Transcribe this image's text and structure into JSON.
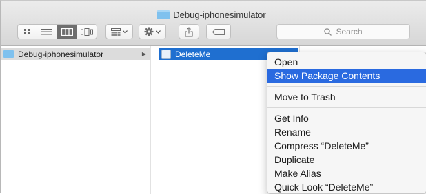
{
  "window": {
    "title": "Debug-iphonesimulator"
  },
  "toolbar": {
    "view_modes": [
      "icon-view-icon",
      "list-view-icon",
      "column-view-icon",
      "cover-flow-icon"
    ],
    "active_view": "column-view-icon",
    "search_placeholder": "Search"
  },
  "columns": [
    {
      "items": [
        {
          "label": "Debug-iphonesimulator",
          "selected": true
        }
      ]
    },
    {
      "items": [
        {
          "label": "DeleteMe",
          "selected": true
        }
      ]
    }
  ],
  "context_menu": {
    "items": [
      "Open",
      "Show Package Contents",
      "Move to Trash",
      "Get Info",
      "Rename",
      "Compress “DeleteMe”",
      "Duplicate",
      "Make Alias",
      "Quick Look “DeleteMe”"
    ],
    "highlighted": "Show Package Contents"
  },
  "colors": {
    "selection_blue": "#1f6fd0",
    "menu_highlight": "#2a6ae0",
    "folder_blue": "#7fc1ee"
  }
}
